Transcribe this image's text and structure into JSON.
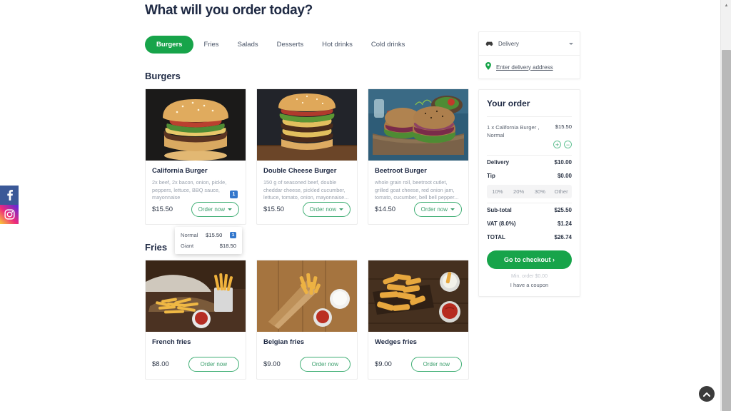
{
  "page": {
    "title": "What will you order today?"
  },
  "tabs": [
    {
      "label": "Burgers",
      "active": true
    },
    {
      "label": "Fries",
      "active": false
    },
    {
      "label": "Salads",
      "active": false
    },
    {
      "label": "Desserts",
      "active": false
    },
    {
      "label": "Hot drinks",
      "active": false
    },
    {
      "label": "Cold drinks",
      "active": false
    }
  ],
  "sections": [
    {
      "title": "Burgers",
      "items": [
        {
          "name": "California Burger",
          "desc": "2x beef, 2x bacon, onion, pickle, peppers, lettuce, BBQ sauce, mayonnaise",
          "price": "$15.50",
          "order_label": "Order now",
          "badge": "1",
          "has_caret": true
        },
        {
          "name": "Double Cheese Burger",
          "desc": "150 g of seasoned beef, double cheddar cheese, pickled cucumber, lettuce, tomato, onion, mayonnaise...",
          "price": "$15.50",
          "order_label": "Order now",
          "badge": "",
          "has_caret": true
        },
        {
          "name": "Beetroot Burger",
          "desc": "whole grain roll, beetroot cutlet, grilled goat cheese, red onion jam, tomato, cucumber, bell bell pepper...",
          "price": "$14.50",
          "order_label": "Order now",
          "badge": "",
          "has_caret": true
        }
      ]
    },
    {
      "title": "Fries",
      "items": [
        {
          "name": "French fries",
          "desc": "",
          "price": "$8.00",
          "order_label": "Order now",
          "badge": "",
          "has_caret": false
        },
        {
          "name": "Belgian fries",
          "desc": "",
          "price": "$9.00",
          "order_label": "Order now",
          "badge": "",
          "has_caret": false
        },
        {
          "name": "Wedges fries",
          "desc": "",
          "price": "$9.00",
          "order_label": "Order now",
          "badge": "",
          "has_caret": false
        }
      ]
    }
  ],
  "size_menu": {
    "options": [
      {
        "label": "Normal",
        "price": "$15.50",
        "badge": "1"
      },
      {
        "label": "Giant",
        "price": "$18.50",
        "badge": ""
      }
    ]
  },
  "sidebar": {
    "delivery_method": "Delivery",
    "address_link": "Enter delivery address",
    "order_title": "Your order",
    "items": [
      {
        "name": "1 x California Burger , Normal",
        "price": "$15.50",
        "plus": "+",
        "minus": "−"
      }
    ],
    "delivery_label": "Delivery",
    "delivery_value": "$10.00",
    "tip_label": "Tip",
    "tip_value": "$0.00",
    "tip_options": [
      "10%",
      "20%",
      "30%",
      "Other"
    ],
    "subtotal_label": "Sub-total",
    "subtotal_value": "$25.50",
    "vat_label": "VAT (8.0%)",
    "vat_value": "$1.24",
    "total_label": "TOTAL",
    "total_value": "$26.74",
    "checkout_label": "Go to checkout ›",
    "min_order": "Min. order $0.00",
    "coupon": "I have a coupon"
  },
  "social": [
    {
      "name": "facebook",
      "glyph": "f"
    },
    {
      "name": "instagram",
      "glyph": "◎"
    }
  ],
  "colors": {
    "brand_green": "#17a44a",
    "outline_green": "#3fae74",
    "badge_blue": "#3377cc",
    "heading": "#1f2a44",
    "muted": "#9aa2ae"
  }
}
